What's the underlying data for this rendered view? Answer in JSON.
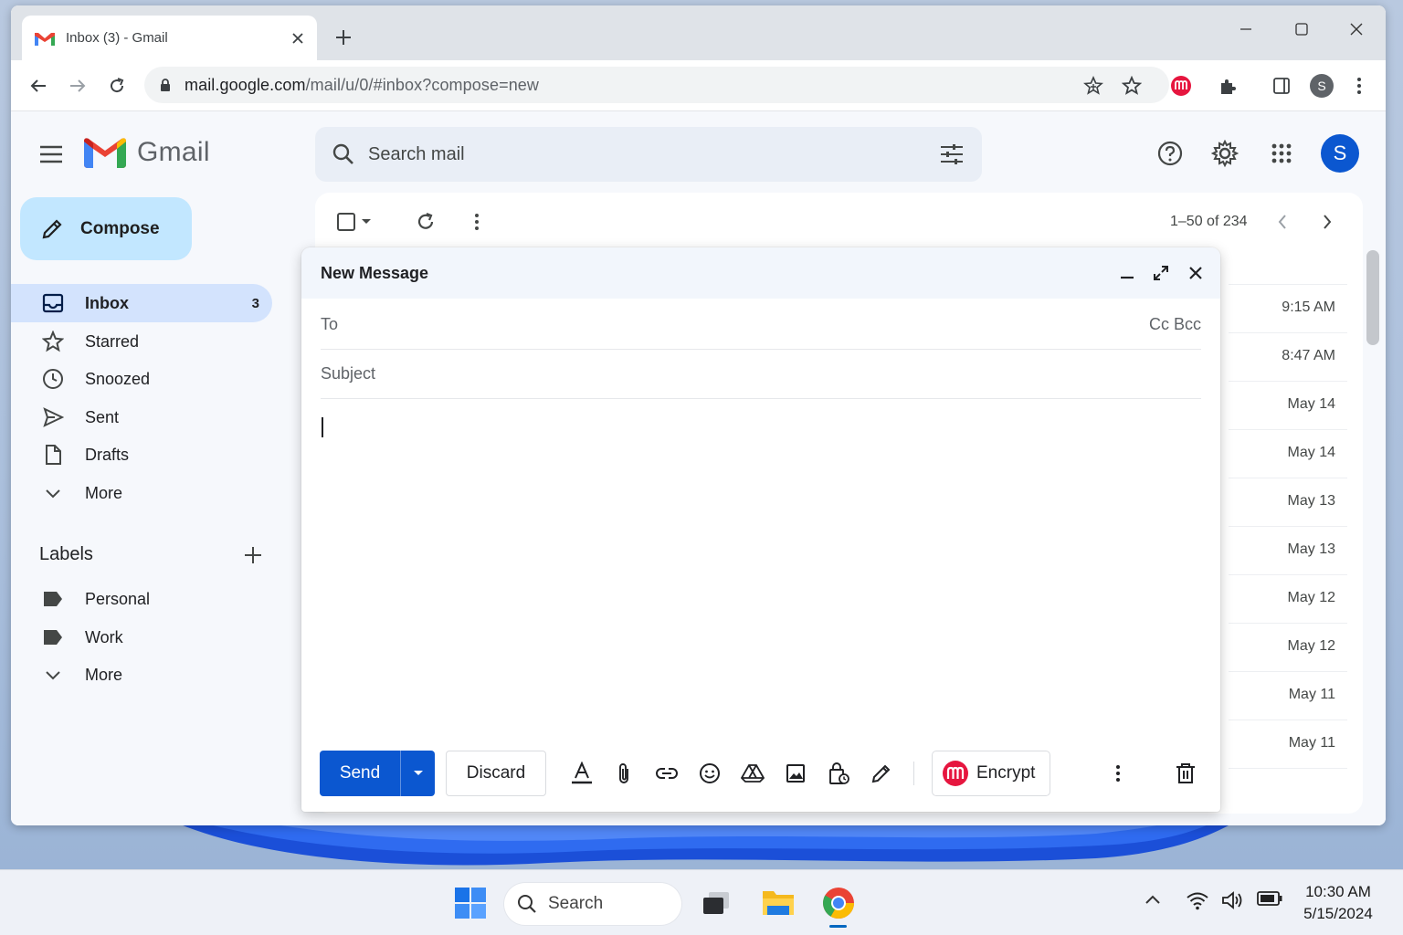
{
  "browser": {
    "tab_title": "Inbox (3) - Gmail",
    "url_host": "mail.google.com",
    "url_path": "/mail/u/0/#inbox?compose=new",
    "profile_initial": "S"
  },
  "gmail": {
    "logo_text": "Gmail",
    "search_placeholder": "Search mail",
    "avatar_initial": "S",
    "compose_label": "Compose",
    "nav": [
      {
        "label": "Inbox",
        "count": "3"
      },
      {
        "label": "Starred"
      },
      {
        "label": "Snoozed"
      },
      {
        "label": "Sent"
      },
      {
        "label": "Drafts"
      },
      {
        "label": "More"
      }
    ],
    "labels_heading": "Labels",
    "labels": [
      {
        "label": "Personal"
      },
      {
        "label": "Work"
      },
      {
        "label": "More"
      }
    ],
    "pagination": "1–50 of 234",
    "email_dates": [
      "9:15 AM",
      "8:47 AM",
      "May 14",
      "May 14",
      "May 13",
      "May 13",
      "May 12",
      "May 12",
      "May 11",
      "May 11"
    ]
  },
  "compose": {
    "title": "New Message",
    "to_label": "To",
    "cc_bcc_label": "Cc Bcc",
    "subject_placeholder": "Subject",
    "send_label": "Send",
    "discard_label": "Discard",
    "encrypt_label": "Encrypt"
  },
  "taskbar": {
    "search_label": "Search",
    "time": "10:30 AM",
    "date": "5/15/2024"
  },
  "colors": {
    "gmail_red": "#ea4335",
    "send_blue": "#0b57d0",
    "compose_btn": "#c2e7ff",
    "inbox_active": "#d3e3fd",
    "avatar_blue": "#0b57d0"
  }
}
